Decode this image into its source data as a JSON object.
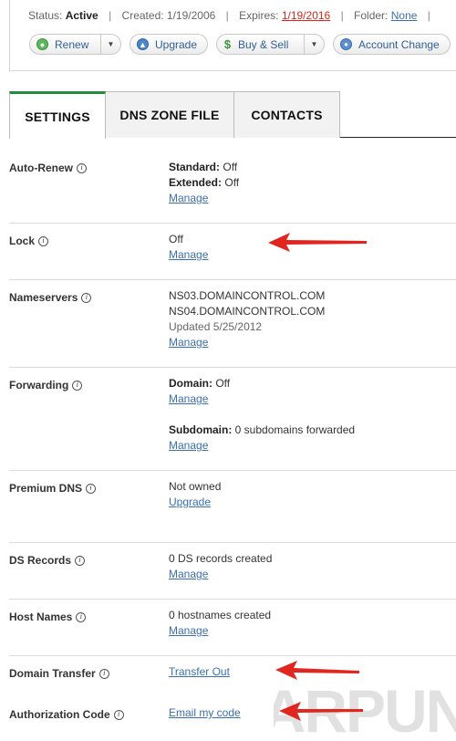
{
  "status": {
    "status_label": "Status:",
    "status_value": "Active",
    "created_label": "Created:",
    "created_value": "1/19/2006",
    "expires_label": "Expires:",
    "expires_value": "1/19/2016",
    "folder_label": "Folder:",
    "folder_value": "None",
    "separator": "|"
  },
  "actions": {
    "renew": "Renew",
    "upgrade": "Upgrade",
    "buy_sell": "Buy & Sell",
    "account_change": "Account Change"
  },
  "tabs": [
    {
      "label": "SETTINGS",
      "active": true
    },
    {
      "label": "DNS ZONE FILE",
      "active": false
    },
    {
      "label": "CONTACTS",
      "active": false
    }
  ],
  "settings": {
    "auto_renew": {
      "label": "Auto-Renew",
      "standard_label": "Standard:",
      "standard_value": "Off",
      "extended_label": "Extended:",
      "extended_value": "Off",
      "link": "Manage"
    },
    "lock": {
      "label": "Lock",
      "value": "Off",
      "link": "Manage"
    },
    "nameservers": {
      "label": "Nameservers",
      "ns1": "NS03.DOMAINCONTROL.COM",
      "ns2": "NS04.DOMAINCONTROL.COM",
      "updated": "Updated 5/25/2012",
      "link": "Manage"
    },
    "forwarding": {
      "label": "Forwarding",
      "domain_label": "Domain:",
      "domain_value": "Off",
      "domain_link": "Manage",
      "subdomain_label": "Subdomain:",
      "subdomain_value": "0 subdomains forwarded",
      "subdomain_link": "Manage"
    },
    "premium_dns": {
      "label": "Premium DNS",
      "value": "Not owned",
      "link": "Upgrade"
    },
    "ds_records": {
      "label": "DS Records",
      "value": "0 DS records created",
      "link": "Manage"
    },
    "host_names": {
      "label": "Host Names",
      "value": "0 hostnames created",
      "link": "Manage"
    },
    "domain_transfer": {
      "label": "Domain Transfer",
      "link": "Transfer Out"
    },
    "authorization_code": {
      "label": "Authorization Code",
      "link": "Email my code"
    }
  },
  "info_glyph": "i",
  "watermark_text": "ARPUN",
  "colors": {
    "accent_green": "#1f8f3a",
    "link_blue": "#3a6fb0",
    "expired_red": "#d9261c",
    "arrow_red": "#e0261f"
  }
}
